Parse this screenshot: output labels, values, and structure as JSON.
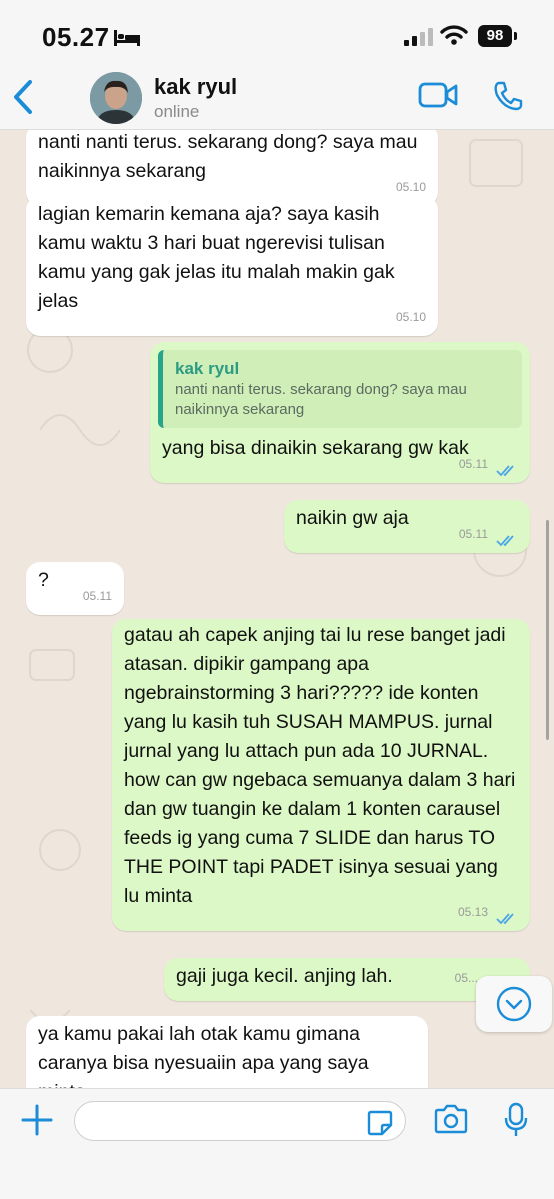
{
  "status_bar": {
    "time": "05.27",
    "battery": "98"
  },
  "header": {
    "contact_name": "kak ryul",
    "status": "online"
  },
  "messages": [
    {
      "direction": "in",
      "text": "nanti nanti terus. sekarang dong? saya mau naikinnya sekarang",
      "time": "05.10"
    },
    {
      "direction": "in",
      "text": "lagian kemarin kemana aja? saya kasih kamu waktu 3 hari buat ngerevisi tulisan kamu yang gak jelas itu malah makin gak jelas",
      "time": "05.10"
    },
    {
      "direction": "out",
      "quote_author": "kak ryul",
      "quote_text": "nanti nanti terus. sekarang dong? saya mau naikinnya sekarang",
      "text": "yang bisa dinaikin sekarang gw kak",
      "time": "05.11",
      "read": true
    },
    {
      "direction": "out",
      "text": "naikin gw aja",
      "time": "05.11",
      "read": true
    },
    {
      "direction": "in",
      "text": "?",
      "time": "05.11"
    },
    {
      "direction": "out",
      "text": "gatau ah capek anjing tai lu rese banget jadi atasan. dipikir gampang apa ngebrainstorming 3 hari????? ide konten yang lu kasih tuh SUSAH MAMPUS. jurnal jurnal yang lu attach pun ada 10 JURNAL. how can gw ngebaca semuanya dalam 3 hari dan gw tuangin ke dalam 1 konten carausel feeds ig yang cuma 7 SLIDE dan harus TO THE POINT tapi PADET isinya sesuai yang lu minta",
      "time": "05.13",
      "read": true
    },
    {
      "direction": "out",
      "text": "gaji juga kecil. anjing lah.",
      "time": "05..."
    },
    {
      "direction": "in",
      "text": "ya kamu pakai lah otak kamu gimana caranya bisa nyesuaiin apa yang saya minta",
      "time": ""
    }
  ],
  "input": {
    "placeholder": ""
  },
  "colors": {
    "accent": "#1a8cd8",
    "incoming": "#ffffff",
    "outgoing": "#dcf8c6",
    "read_ticks": "#4aa6e8",
    "quote_bar": "#29a38a"
  },
  "icons": [
    "bed-icon",
    "signal-icon",
    "wifi-icon",
    "back-icon",
    "video-call-icon",
    "phone-call-icon",
    "double-check-icon",
    "chevron-down-icon",
    "plus-icon",
    "sticker-icon",
    "camera-icon",
    "mic-icon"
  ]
}
